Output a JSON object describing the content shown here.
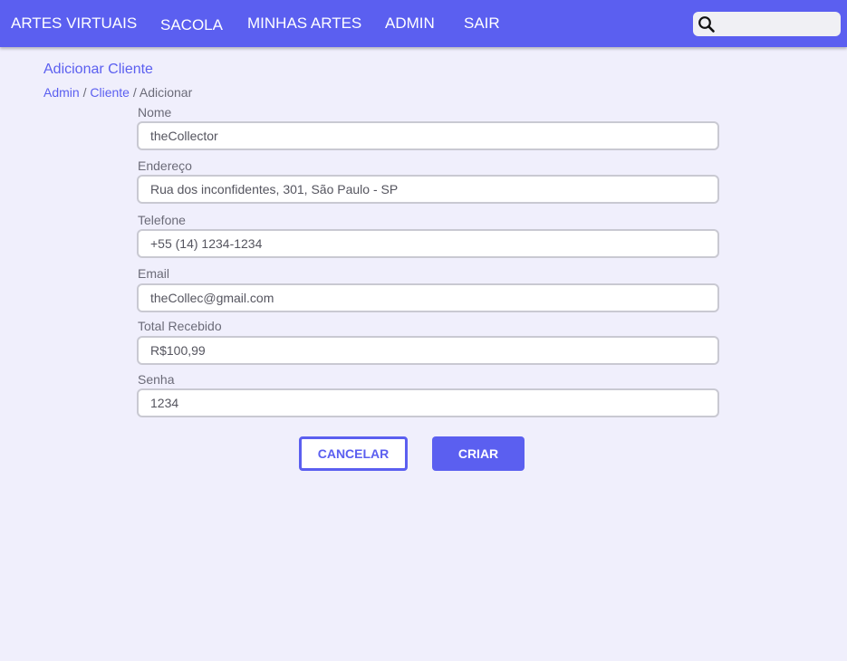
{
  "navbar": {
    "brand": "ARTES VIRTUAIS",
    "links": [
      "SACOLA",
      "MINHAS ARTES",
      "ADMIN",
      "SAIR"
    ],
    "search": {
      "icon": "search-icon",
      "value": ""
    }
  },
  "page": {
    "title": "Adicionar Cliente",
    "breadcrumb": {
      "admin": "Admin",
      "separator": "/",
      "cliente": "Cliente",
      "current": "Adicionar"
    }
  },
  "form": {
    "fields": [
      {
        "label": "Nome",
        "value": "theCollector"
      },
      {
        "label": "Endereço",
        "value": "Rua dos inconfidentes, 301, São Paulo - SP"
      },
      {
        "label": "Telefone",
        "value": "+55 (14) 1234-1234"
      },
      {
        "label": "Email",
        "value": "theCollec@gmail.com"
      },
      {
        "label": "Total Recebido",
        "value": "R$100,99"
      },
      {
        "label": "Senha",
        "value": "1234"
      }
    ],
    "cancel_label": "CANCELAR",
    "create_label": "CRIAR"
  },
  "colors": {
    "accent": "#5b5ff0",
    "background": "#f0effc",
    "input_border": "#c9c9d2",
    "text_muted": "#6b6b78"
  }
}
